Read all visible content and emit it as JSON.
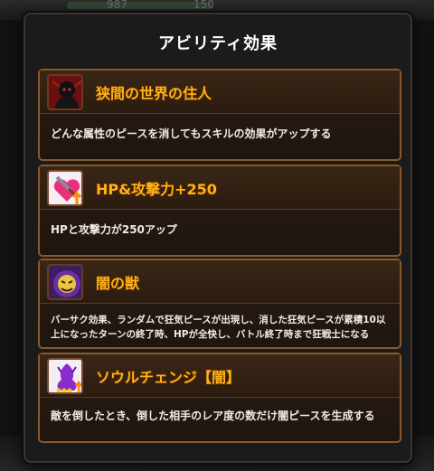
{
  "background": {
    "hp_number": "987",
    "sub_number": "150"
  },
  "modal": {
    "title": "アビリティ効果"
  },
  "abilities": [
    {
      "name": "狭間の世界の住人",
      "icon": "shadow-figure-icon",
      "description": "どんな属性のピースを消してもスキルの効果がアップする"
    },
    {
      "name": "HP&攻撃力+250",
      "icon": "heart-sword-up-icon",
      "description": "HPと攻撃力が250アップ"
    },
    {
      "name": "闇の獣",
      "icon": "dark-beast-icon",
      "description": "バーサク効果、ランダムで狂気ピースが出現し、消した狂気ピースが累積10以上になったターンの終了時、HPが全快し、バトル終了時まで狂戦士になる"
    },
    {
      "name": "ソウルチェンジ【闇】",
      "icon": "soul-change-dark-icon",
      "description": "敵を倒したとき、倒した相手のレア度の数だけ闇ピースを生成する"
    }
  ],
  "colors": {
    "title_orange": "#ffb21a",
    "card_border": "#8a5a2e",
    "modal_bg": "#1b1b1b"
  }
}
